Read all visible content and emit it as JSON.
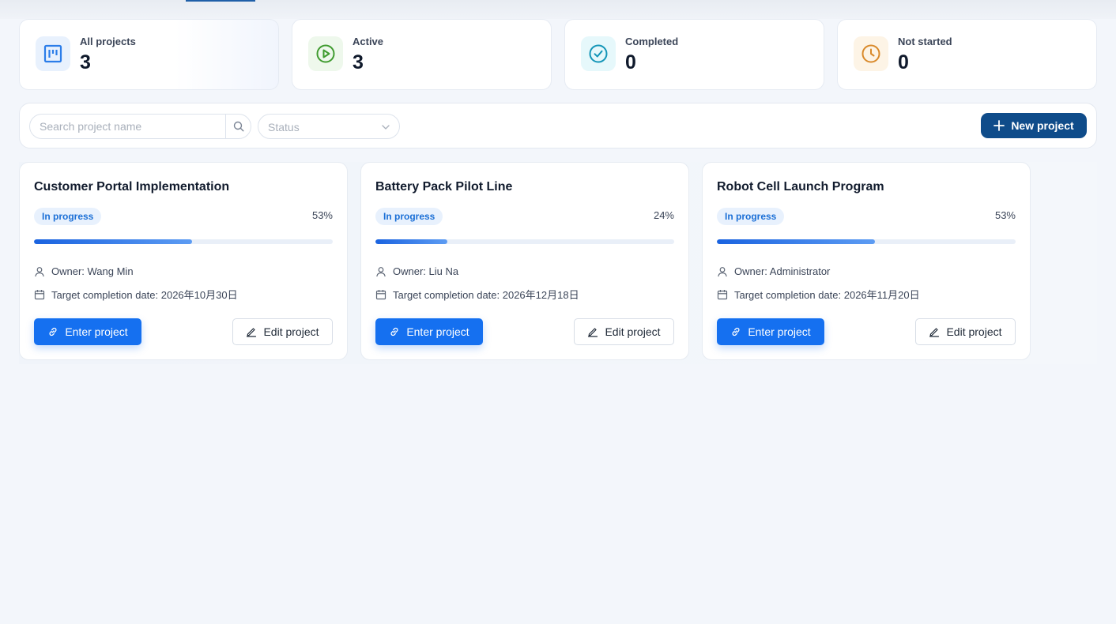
{
  "stats": [
    {
      "label": "All projects",
      "value": "3",
      "icon": "board-icon",
      "color": "#2b7de9",
      "bg": "#e8f1fd"
    },
    {
      "label": "Active",
      "value": "3",
      "icon": "play-circle-icon",
      "color": "#3f9b2f",
      "bg": "#eef8ec"
    },
    {
      "label": "Completed",
      "value": "0",
      "icon": "check-circle-icon",
      "color": "#1596b8",
      "bg": "#e6f8fb"
    },
    {
      "label": "Not started",
      "value": "0",
      "icon": "clock-icon",
      "color": "#d98a2b",
      "bg": "#fdf4e6"
    }
  ],
  "toolbar": {
    "search_placeholder": "Search project name",
    "status_placeholder": "Status",
    "new_project_label": "New project",
    "accent": "#0f4c8a"
  },
  "projects": [
    {
      "title": "Customer Portal Implementation",
      "status": "In progress",
      "progress": 53,
      "progress_label": "53%",
      "owner": "Owner: Wang Min",
      "target_date": "Target completion date: 2026年10月30日",
      "enter_label": "Enter project",
      "edit_label": "Edit project"
    },
    {
      "title": "Battery Pack Pilot Line",
      "status": "In progress",
      "progress": 24,
      "progress_label": "24%",
      "owner": "Owner: Liu Na",
      "target_date": "Target completion date: 2026年12月18日",
      "enter_label": "Enter project",
      "edit_label": "Edit project"
    },
    {
      "title": "Robot Cell Launch Program",
      "status": "In progress",
      "progress": 53,
      "progress_label": "53%",
      "owner": "Owner: Administrator",
      "target_date": "Target completion date: 2026年11月20日",
      "enter_label": "Enter project",
      "edit_label": "Edit project"
    }
  ]
}
